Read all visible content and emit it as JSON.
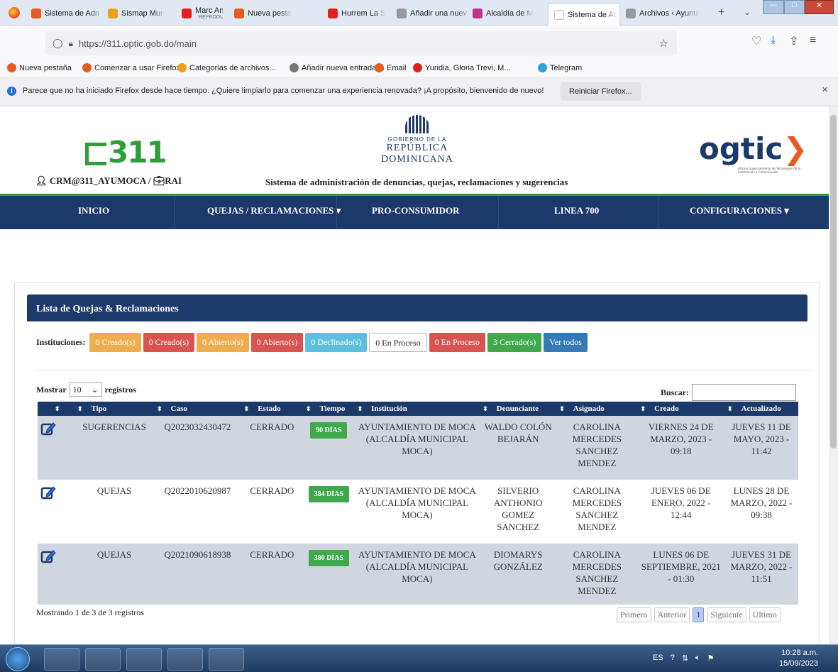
{
  "browser": {
    "tabs": [
      {
        "label": "Sistema de Admi",
        "color": "#e65c1e"
      },
      {
        "label": "Sismap Mun",
        "color": "#e8a21e"
      },
      {
        "label": "Marc Anthon",
        "sub": "REPRODUCIENDO",
        "color": "#e0201e"
      },
      {
        "label": "Nueva pesta",
        "color": "#e65c1e"
      },
      {
        "label": "Hurrem La S",
        "color": "#e0201e"
      },
      {
        "label": "Añadir una nueva",
        "color": "#999999"
      },
      {
        "label": "Alcaldía de M",
        "color": "#c2338b"
      },
      {
        "label": "Sistema de Ad",
        "color": "#ffffff"
      },
      {
        "label": "Archivos ‹ Ayunta",
        "color": "#999999"
      }
    ],
    "close_tab": "✕",
    "new_tab": "+",
    "url": "https://311.optic.gob.do/main",
    "url_host": "311.optic.gob.do",
    "bookmarks": [
      {
        "label": "Nueva pestaña",
        "color": "#e65c1e"
      },
      {
        "label": "Comenzar a usar Firefox",
        "color": "#e65c1e"
      },
      {
        "label": "Categorias de archivos...",
        "color": "#e8a21e"
      },
      {
        "label": "Añadir nueva entrada ...",
        "color": "#777777"
      },
      {
        "label": "Email",
        "color": "#e65c1e"
      },
      {
        "label": "Yuridia, Gloria Trevi, M...",
        "color": "#e0201e"
      },
      {
        "label": "Telegram",
        "color": "#2aa3dd"
      }
    ],
    "notification": "Parece que no ha iniciado Firefox desde hace tiempo. ¿Quiere limpiarlo para comenzar una experiencia renovada? ¡A propósito, bienvenido de nuevo!",
    "notification_button": "Reiniciar Firefox...",
    "notification_close": "✕"
  },
  "header": {
    "logo_311": "311",
    "gov_small": "GOBIERNO DE LA",
    "gov_big": "REPÚBLICA DOMINICANA",
    "ogtic": "ogtic",
    "ogtic_sub": "Oficina Gubernamental de Tecnologías de la Información y Comunicación",
    "user": "CRM@311_AYUMOCA / ",
    "role": "RAI",
    "system_title": "Sistema de administración de denuncias, quejas, reclamaciones y sugerencias"
  },
  "nav": {
    "items": [
      {
        "label": "INICIO"
      },
      {
        "label": "QUEJAS / RECLAMACIONES ▾"
      },
      {
        "label": "PRO-CONSUMIDOR"
      },
      {
        "label": "LINEA 700"
      },
      {
        "label": "CONFIGURACIONES ▾"
      }
    ]
  },
  "panel": {
    "title": "Lista de Quejas & Reclamaciones",
    "filters_label": "Instituciones:",
    "filters": [
      {
        "label": "0 Creado(s)",
        "color": "#f0ad4e"
      },
      {
        "label": "0 Creado(s)",
        "color": "#d9534f"
      },
      {
        "label": "0 Abierto(s)",
        "color": "#f0ad4e"
      },
      {
        "label": "0 Abierto(s)",
        "color": "#d9534f"
      },
      {
        "label": "0 Declinado(s)",
        "color": "#5bc0de"
      },
      {
        "label": "0 En Proceso",
        "color": "#ffffff"
      },
      {
        "label": "0 En Proceso",
        "color": "#d9534f"
      },
      {
        "label": "3 Cerrado(s)",
        "color": "#3ea84b"
      },
      {
        "label": "Ver todos",
        "color": "#337ab7"
      }
    ],
    "show_label": "Mostrar",
    "show_value": "10",
    "records_label": "registros",
    "search_label": "Buscar:",
    "columns": [
      "",
      "Tipo",
      "Caso",
      "Estado",
      "Tiempo",
      "Institución",
      "Denunciante",
      "Asignado",
      "Creado",
      "Actualizado"
    ],
    "rows": [
      {
        "tipo": "SUGERENCIAS",
        "caso": "Q2023032430472",
        "estado": "CERRADO",
        "tiempo": "90 DÍAS",
        "institucion": "AYUNTAMIENTO DE MOCA (ALCALDÍA MUNICIPAL MOCA)",
        "denunciante": "WALDO COLÓN BEJARÁN",
        "asignado": "CAROLINA MERCEDES SANCHEZ MENDEZ",
        "creado": "VIERNES 24 DE MARZO, 2023 - 09:18",
        "actualizado": "JUEVES 11 DE MAYO, 2023 - 11:42"
      },
      {
        "tipo": "QUEJAS",
        "caso": "Q2022010620987",
        "estado": "CERRADO",
        "tiempo": "384 DÍAS",
        "institucion": "AYUNTAMIENTO DE MOCA (ALCALDÍA MUNICIPAL MOCA)",
        "denunciante": "SILVERIO ANTHONIO GOMEZ SANCHEZ",
        "asignado": "CAROLINA MERCEDES SANCHEZ MENDEZ",
        "creado": "JUEVES 06 DE ENERO, 2022 - 12:44",
        "actualizado": "LUNES 28 DE MARZO, 2022 - 09:38"
      },
      {
        "tipo": "QUEJAS",
        "caso": "Q2021090618938",
        "estado": "CERRADO",
        "tiempo": "380 DÍAS",
        "institucion": "AYUNTAMIENTO DE MOCA (ALCALDÍA MUNICIPAL MOCA)",
        "denunciante": "DIOMARYS GONZÁLEZ",
        "asignado": "CAROLINA MERCEDES SANCHEZ MENDEZ",
        "creado": "LUNES 06 DE SEPTIEMBRE, 2021 - 01:30",
        "actualizado": "JUEVES 31 DE MARZO, 2022 - 11:51"
      }
    ],
    "info": "Mostrando 1 de 3 de 3 registros",
    "pager": [
      "Primero",
      "Anterior",
      "1",
      "Siguiente",
      "Ultimo"
    ]
  },
  "taskbar": {
    "lang": "ES",
    "time": "10:28 a.m.",
    "date": "15/09/2023"
  }
}
